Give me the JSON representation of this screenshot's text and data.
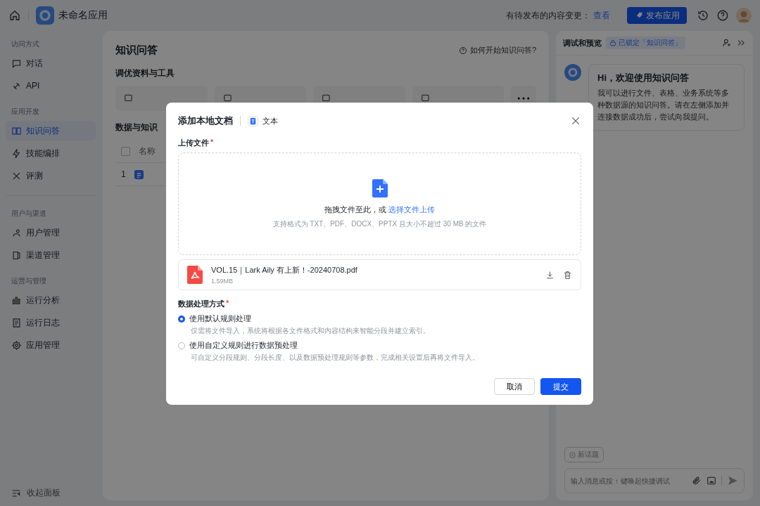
{
  "topbar": {
    "app_name": "未命名应用",
    "pending_label": "有待发布的内容变更：",
    "pending_link": "查看",
    "publish_button": "发布应用"
  },
  "sidebar": {
    "sections": [
      {
        "title": "访问方式",
        "items": [
          {
            "label": "对话",
            "selected": false
          },
          {
            "label": "API",
            "selected": false
          }
        ]
      },
      {
        "title": "应用开发",
        "items": [
          {
            "label": "知识问答",
            "selected": true
          },
          {
            "label": "技能编排",
            "selected": false
          },
          {
            "label": "评测",
            "selected": false
          }
        ]
      },
      {
        "title": "用户与渠道",
        "items": [
          {
            "label": "用户管理",
            "selected": false
          },
          {
            "label": "渠道管理",
            "selected": false
          }
        ]
      },
      {
        "title": "运营与管理",
        "items": [
          {
            "label": "运行分析",
            "selected": false
          },
          {
            "label": "运行日志",
            "selected": false
          },
          {
            "label": "应用管理",
            "selected": false
          }
        ]
      }
    ],
    "collapse_label": "收起面板"
  },
  "main": {
    "title": "知识问答",
    "help_link": "如何开始知识问答?",
    "tools_title": "调优资料与工具",
    "data_title": "数据与知识",
    "table": {
      "select_all": {
        "checked": false
      },
      "columns": [
        "名称"
      ],
      "rows": [
        {
          "index": "1"
        }
      ]
    }
  },
  "preview": {
    "title": "调试和预览",
    "lock_badge": "已锁定「知识问答」",
    "greeting_title": "Hi，欢迎使用知识问答",
    "greeting_body": "我可以进行文件、表格、业务系统等多种数据源的知识问答。请在左侧添加并连接数据成功后，尝试向我提问。",
    "new_topic": "新话题",
    "input_placeholder": "输入消息或按 ↑ 键唤起快捷调试"
  },
  "modal": {
    "title": "添加本地文档",
    "type_label": "文本",
    "upload_label": "上传文件",
    "upload_required": "*",
    "drop_text": "拖拽文件至此，或",
    "drop_link": "选择文件上传",
    "formats_hint": "支持格式为 TXT、PDF、DOCX、PPTX 且大小不超过 30 MB 的文件",
    "file": {
      "name": "VOL.15｜Lark Aily 有上新！-20240708.pdf",
      "size": "1.59MB"
    },
    "processing_label": "数据处理方式",
    "processing_required": "*",
    "options": [
      {
        "label": "使用默认规则处理",
        "description": "仅需将文件导入，系统将根据各文件格式和内容结构来智能分段并建立索引。",
        "selected": true
      },
      {
        "label": "使用自定义规则进行数据预处理",
        "description": "可自定义分段规则、分段长度、以及数据预处理规则等参数，完成相关设置后再将文件导入。",
        "selected": false
      }
    ],
    "cancel_button": "取消",
    "submit_button": "提交"
  }
}
